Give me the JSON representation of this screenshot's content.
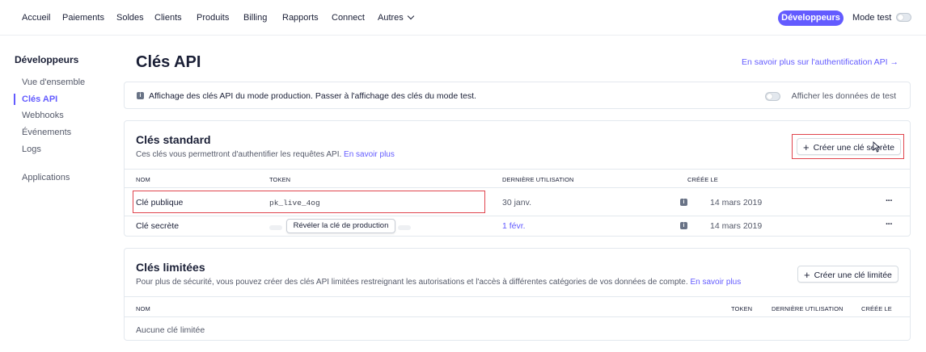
{
  "topnav": {
    "items": [
      "Accueil",
      "Paiements",
      "Soldes",
      "Clients",
      "Produits",
      "Billing",
      "Rapports",
      "Connect",
      "Autres"
    ],
    "developers_label": "Développeurs",
    "test_mode_label": "Mode test"
  },
  "sidebar": {
    "title": "Développeurs",
    "items": [
      "Vue d'ensemble",
      "Clés API",
      "Webhooks",
      "Événements",
      "Logs",
      "Applications"
    ]
  },
  "header": {
    "title": "Clés API",
    "auth_link": "En savoir plus sur l'authentification API →"
  },
  "banner": {
    "text": "Affichage des clés API du mode production. Passer à l'affichage des clés du mode test.",
    "toggle_label": "Afficher les données de test"
  },
  "standard": {
    "title": "Clés standard",
    "subtitle": "Ces clés vous permettront d'authentifier les requêtes API.",
    "learn_more": "En savoir plus",
    "create_button": "Créer une clé secrète",
    "columns": [
      "NOM",
      "TOKEN",
      "DERNIÈRE UTILISATION",
      "CRÉÉE LE"
    ],
    "rows": [
      {
        "name": "Clé publique",
        "token": "pk_live_4og",
        "last_used": "30 janv.",
        "created": "14 mars 2019",
        "more": "···"
      },
      {
        "name": "Clé secrète",
        "token": "",
        "last_used": "1 févr.",
        "created": "14 mars 2019",
        "more": "···"
      }
    ],
    "reveal_button": "Révéler la clé de production"
  },
  "restricted": {
    "title": "Clés limitées",
    "subtitle": "Pour plus de sécurité, vous pouvez créer des clés API limitées restreignant les autorisations et l'accès à différentes catégories de vos données de compte.",
    "learn_more": "En savoir plus",
    "create_button": "Créer une clé limitée",
    "columns": [
      "NOM",
      "TOKEN",
      "DERNIÈRE UTILISATION",
      "CRÉÉE LE"
    ],
    "empty": "Aucune clé limitée"
  },
  "colors": {
    "accent": "#635bff",
    "highlight": "#e0444d",
    "text": "#1a1f36",
    "muted": "#545969"
  },
  "icons": [
    "chevron-down-icon",
    "info-icon",
    "plus-icon",
    "more-icon",
    "cursor-icon"
  ]
}
